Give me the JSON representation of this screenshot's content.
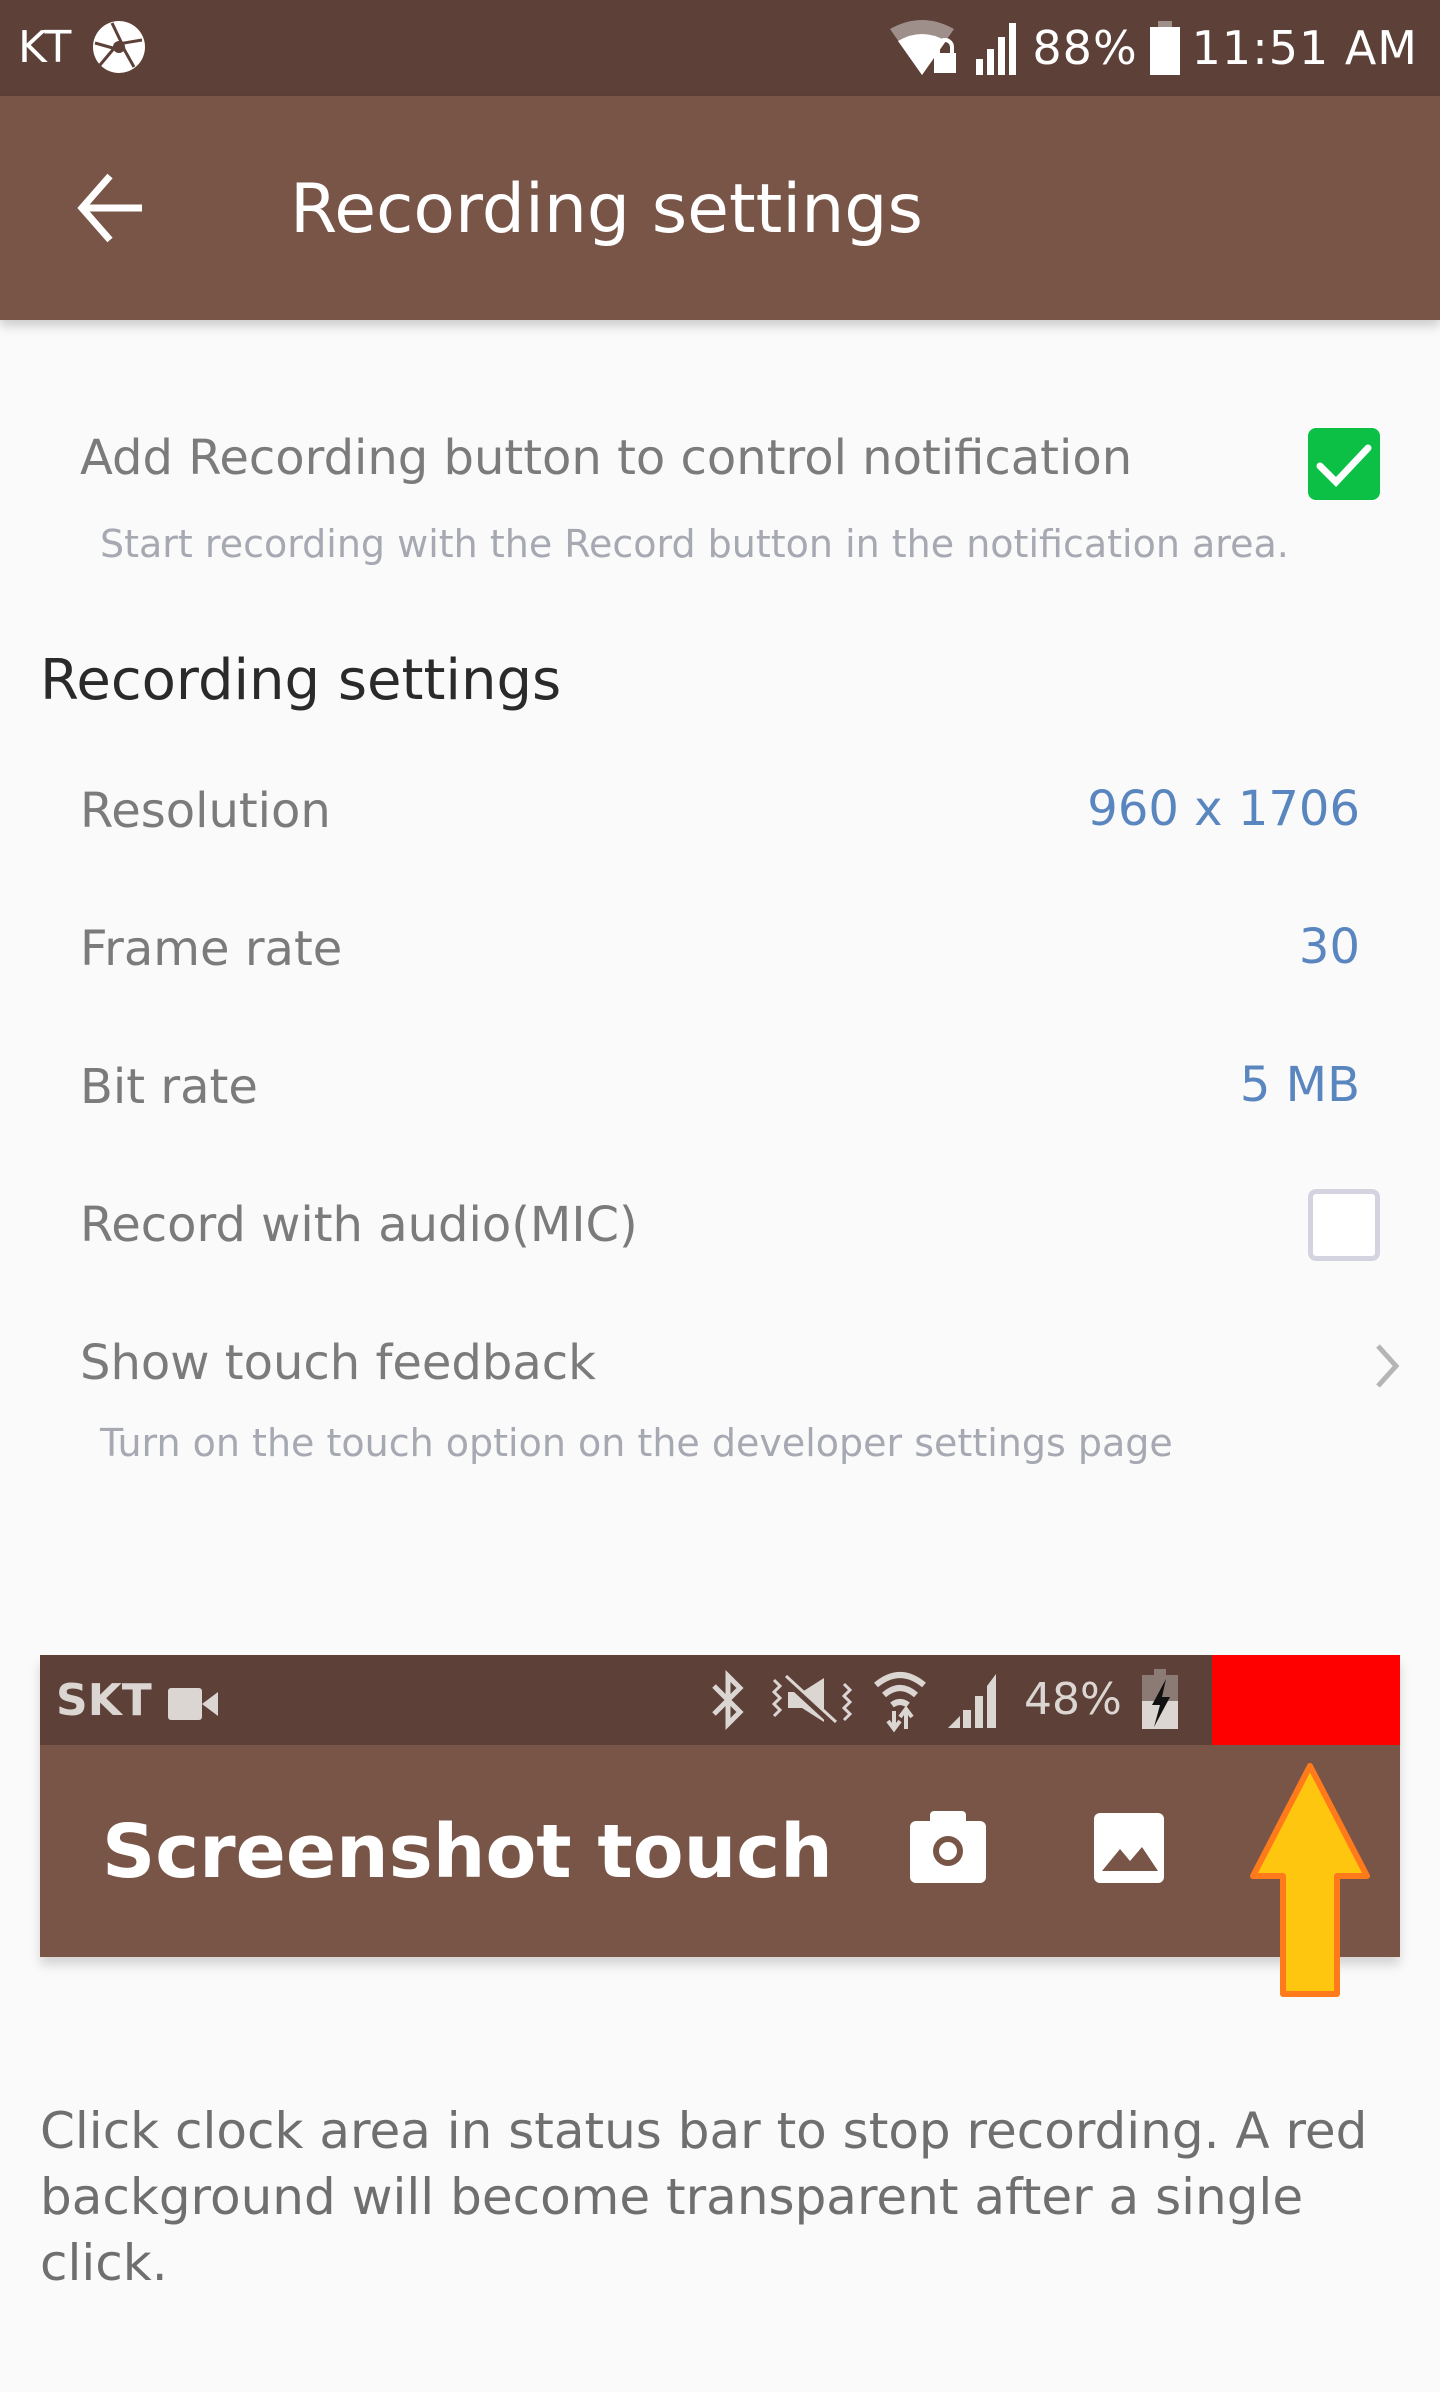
{
  "status_bar": {
    "carrier": "KT",
    "battery_percent": "88%",
    "time": "11:51 AM",
    "icons": [
      "aperture-icon",
      "wifi-lock-icon",
      "signal-icon",
      "battery-icon"
    ]
  },
  "app_bar": {
    "back_icon": "arrow-back-icon",
    "title": "Recording settings"
  },
  "notification_option": {
    "title": "Add Recording button to control notification",
    "subtitle": "Start recording with the Record button in the notification area.",
    "checked": true
  },
  "section": {
    "header": "Recording settings",
    "items": [
      {
        "label": "Resolution",
        "value": "960 x 1706"
      },
      {
        "label": "Frame rate",
        "value": "30"
      },
      {
        "label": "Bit rate",
        "value": "5 MB"
      }
    ],
    "audio": {
      "label": "Record with audio(MIC)",
      "checked": false
    },
    "touch_feedback": {
      "label": "Show touch feedback",
      "subtitle": "Turn on the touch option on the developer settings page"
    }
  },
  "preview": {
    "carrier": "SKT",
    "battery_percent": "48%",
    "app_title": "Screenshot touch",
    "status_icons": [
      "videocam-icon",
      "bluetooth-icon",
      "vibrate-mute-icon",
      "wifi-transfer-icon",
      "signal-icon",
      "battery-charging-icon"
    ],
    "buttons": [
      "camera-icon",
      "gallery-icon"
    ],
    "highlight_color": "#ff0000",
    "arrow_color": "#ffc60f"
  },
  "footer_note": "Click clock area in status bar to stop recording. A red background will become transparent after a single click.",
  "colors": {
    "status_bar": "#5d4037",
    "app_bar": "#795548",
    "accent_value": "#5a86c0",
    "checkbox_on": "#0cbf45"
  }
}
